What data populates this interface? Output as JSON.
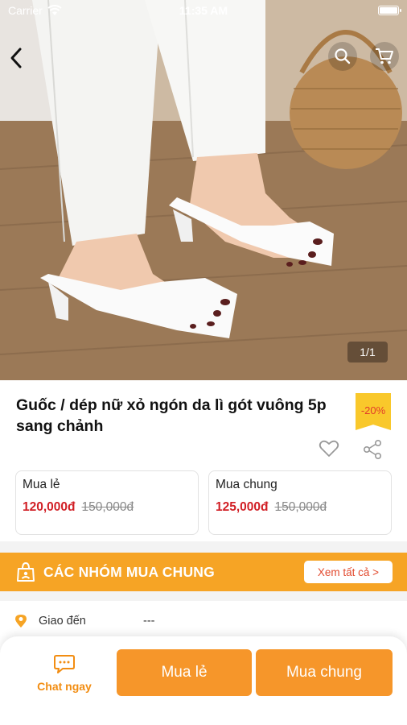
{
  "status_bar": {
    "carrier": "Carrier",
    "time": "11:35 AM"
  },
  "hero": {
    "image_counter": "1/1"
  },
  "product": {
    "title": "Guốc / dép nữ xỏ ngón da lì gót vuông 5p sang chảnh",
    "discount_badge": "-20%"
  },
  "prices": {
    "single": {
      "label": "Mua lẻ",
      "current": "120,000đ",
      "original": "150,000đ"
    },
    "group": {
      "label": "Mua chung",
      "current": "125,000đ",
      "original": "150,000đ"
    }
  },
  "group_section": {
    "title": "CÁC NHÓM MUA CHUNG",
    "see_all": "Xem tất cả >"
  },
  "shipping": {
    "label": "Giao đến",
    "value": "---"
  },
  "bottom_bar": {
    "chat_label": "Chat ngay",
    "buy_single_label": "Mua lẻ",
    "buy_group_label": "Mua chung"
  },
  "colors": {
    "accent_orange": "#f6a425",
    "button_orange": "#f6962a",
    "price_red": "#d11f25",
    "badge_yellow": "#f9c82b"
  },
  "icons": [
    "wifi-icon",
    "battery-icon",
    "back-arrow-icon",
    "search-icon",
    "cart-icon",
    "heart-icon",
    "share-icon",
    "group-bag-icon",
    "location-pin-icon",
    "chat-bubble-icon"
  ]
}
